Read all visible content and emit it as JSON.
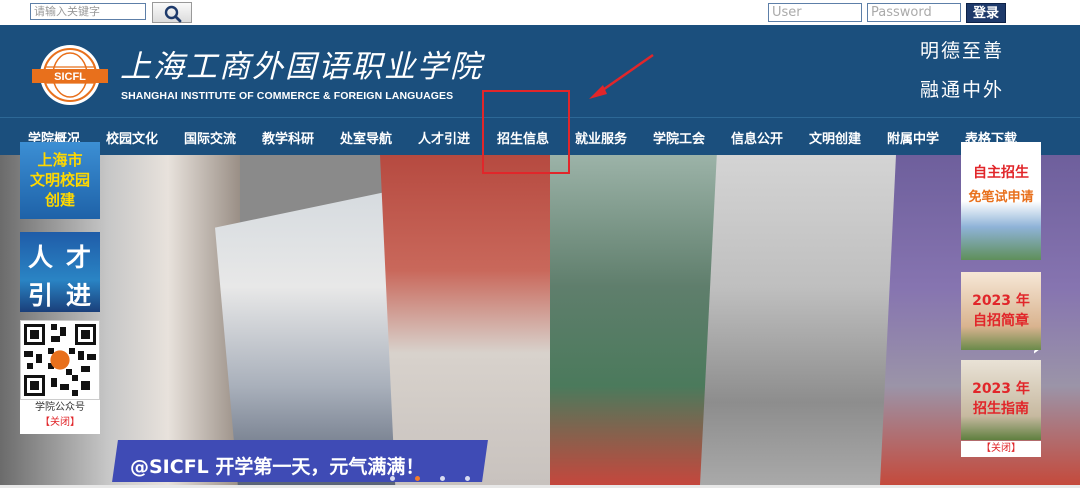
{
  "search": {
    "placeholder": "请输入关键字"
  },
  "login": {
    "user_placeholder": "User",
    "password_placeholder": "Password",
    "button_label": "登录"
  },
  "header": {
    "cn_title": "上海工商外国语职业学院",
    "en_title": "SHANGHAI INSTITUTE OF COMMERCE & FOREIGN LANGUAGES",
    "logo_text": "SICFL",
    "motto": [
      "明德至善",
      "融通中外"
    ]
  },
  "nav": {
    "items": [
      "学院概况",
      "校园文化",
      "国际交流",
      "教学科研",
      "处室导航",
      "人才引进",
      "招生信息",
      "就业服务",
      "学院工会",
      "信息公开",
      "文明创建",
      "附属中学",
      "表格下载"
    ]
  },
  "banner": {
    "caption": "@SICFL 开学第一天，元气满满！"
  },
  "left_floats": {
    "civil_lines": [
      "上海市",
      "文明校园",
      "创建"
    ],
    "talent_chars": [
      "人",
      "才",
      "引",
      "进"
    ],
    "qr_caption": "学院公众号",
    "close_label": "【关闭】"
  },
  "right_floats": {
    "enroll_lines": [
      "自主招生",
      "免笔试申请"
    ],
    "brochure_lines": [
      "2023 年",
      "自招简章"
    ],
    "guide_lines": [
      "2023 年",
      "招生指南"
    ],
    "close_label": "【关闭】"
  },
  "colors": {
    "header_bg": "#1b4f7d",
    "highlight": "#e1262a",
    "caption_bg": "#3f4bb5"
  }
}
